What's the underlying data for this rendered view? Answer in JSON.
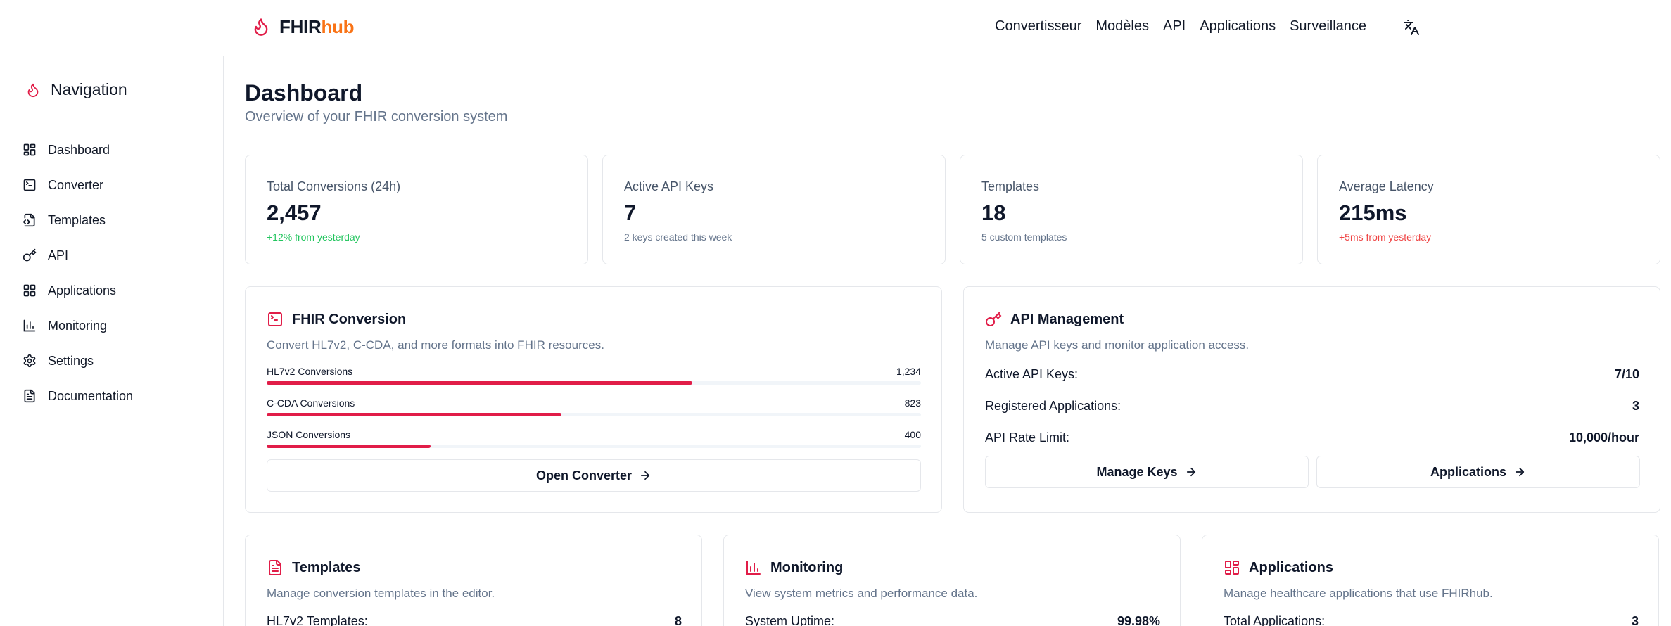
{
  "header": {
    "brand_part1": "FHIR",
    "brand_part2": "hub",
    "nav": [
      "Convertisseur",
      "Modèles",
      "API",
      "Applications",
      "Surveillance"
    ],
    "translate_icon": "translate-icon"
  },
  "sidebar": {
    "title": "Navigation",
    "items": [
      {
        "label": "Dashboard",
        "icon": "dashboard-icon"
      },
      {
        "label": "Converter",
        "icon": "terminal-icon"
      },
      {
        "label": "Templates",
        "icon": "file-code-icon"
      },
      {
        "label": "API",
        "icon": "key-icon"
      },
      {
        "label": "Applications",
        "icon": "grid-icon"
      },
      {
        "label": "Monitoring",
        "icon": "bar-chart-icon"
      },
      {
        "label": "Settings",
        "icon": "gear-icon"
      },
      {
        "label": "Documentation",
        "icon": "document-icon"
      }
    ]
  },
  "main": {
    "title": "Dashboard",
    "subtitle": "Overview of your FHIR conversion system",
    "stats": [
      {
        "label": "Total Conversions (24h)",
        "value": "2,457",
        "note": "+12% from yesterday"
      },
      {
        "label": "Active API Keys",
        "value": "7",
        "note": "2 keys created this week"
      },
      {
        "label": "Templates",
        "value": "18",
        "note": "5 custom templates"
      },
      {
        "label": "Average Latency",
        "value": "215ms",
        "note": "+5ms from yesterday"
      }
    ],
    "conversion": {
      "title": "FHIR Conversion",
      "description": "Convert HL7v2, C-CDA, and more formats into FHIR resources.",
      "rows": [
        {
          "label": "HL7v2 Conversions",
          "value": "1,234",
          "fraction": 0.65
        },
        {
          "label": "C-CDA Conversions",
          "value": "823",
          "fraction": 0.45
        },
        {
          "label": "JSON Conversions",
          "value": "400",
          "fraction": 0.25
        }
      ],
      "button": "Open Converter"
    },
    "api": {
      "title": "API Management",
      "description": "Manage API keys and monitor application access.",
      "rows": [
        {
          "label": "Active API Keys:",
          "value": "7/10"
        },
        {
          "label": "Registered Applications:",
          "value": "3"
        },
        {
          "label": "API Rate Limit:",
          "value": "10,000/hour"
        }
      ],
      "button_keys": "Manage Keys",
      "button_apps": "Applications"
    },
    "templates": {
      "title": "Templates",
      "description": "Manage conversion templates in the editor.",
      "row": {
        "label": "HL7v2 Templates:",
        "value": "8"
      }
    },
    "monitoring": {
      "title": "Monitoring",
      "description": "View system metrics and performance data.",
      "row": {
        "label": "System Uptime:",
        "value": "99.98%"
      }
    },
    "applications": {
      "title": "Applications",
      "description": "Manage healthcare applications that use FHIRhub.",
      "row": {
        "label": "Total Applications:",
        "value": "3"
      }
    }
  },
  "colors": {
    "accent": "#e11d48",
    "brand_orange": "#f97316",
    "positive": "#22c55e",
    "negative": "#ef4444"
  }
}
